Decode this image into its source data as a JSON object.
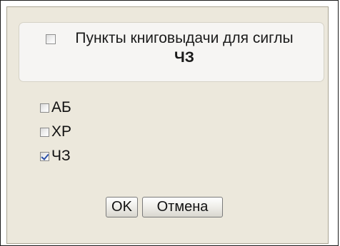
{
  "header": {
    "title_prefix": "Пункты книговыдачи для сиглы",
    "title_sigla": "ЧЗ",
    "checked": false
  },
  "options": [
    {
      "label": "АБ",
      "checked": false
    },
    {
      "label": "ХР",
      "checked": false
    },
    {
      "label": "ЧЗ",
      "checked": true
    }
  ],
  "buttons": {
    "ok": "OK",
    "cancel": "Отмена"
  },
  "colors": {
    "panel_background": "#ece8dc",
    "header_background": "#f6f5f3",
    "check_mark": "#2a4fa8"
  }
}
